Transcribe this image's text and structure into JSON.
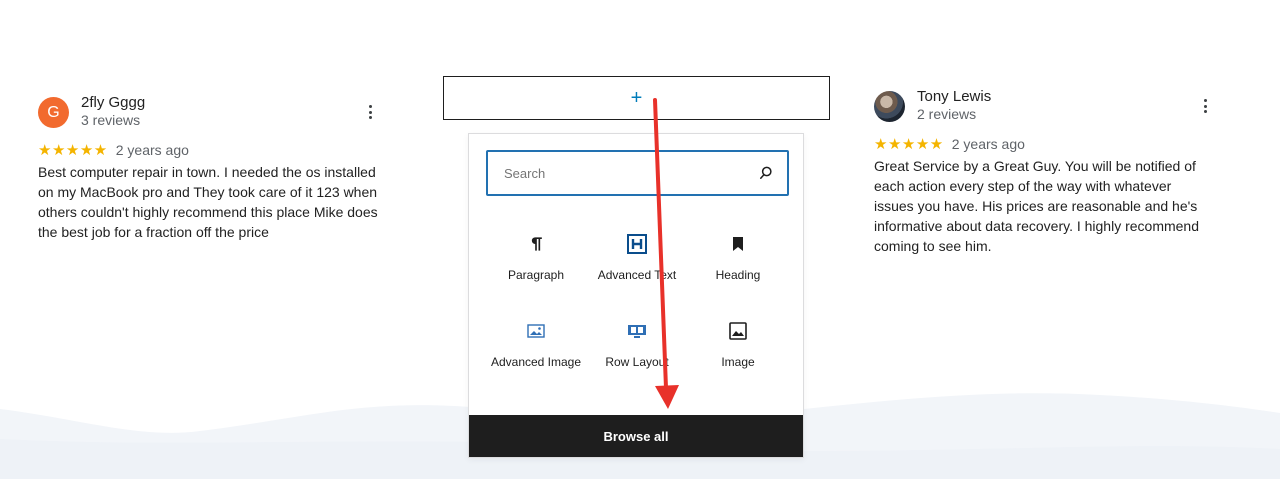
{
  "reviews": [
    {
      "initial": "G",
      "name": "2fly Gggg",
      "count": "3 reviews",
      "stars": "★★★★★",
      "ago": "2 years ago",
      "text": "Best computer repair in town. I needed the os installed on my MacBook pro and They took care of it 123 when others couldn't highly recommend this place Mike does the best job for a fraction off the price"
    },
    {
      "initial": "",
      "name": "Tony Lewis",
      "count": "2 reviews",
      "stars": "★★★★★",
      "ago": "2 years ago",
      "text": "Great Service by a Great Guy. You will be notified of each action every step of the way with whatever issues you have. His prices are reasonable and he's informative about data recovery. I highly recommend coming to see him."
    }
  ],
  "appender": {
    "symbol": "+"
  },
  "inserter": {
    "search_placeholder": "Search",
    "blocks": [
      {
        "label": "Paragraph",
        "icon": "paragraph-icon"
      },
      {
        "label": "Advanced Text",
        "icon": "advanced-heading-icon"
      },
      {
        "label": "Heading",
        "icon": "bookmark-icon"
      },
      {
        "label": "Advanced Image",
        "icon": "advanced-image-icon"
      },
      {
        "label": "Row Layout",
        "icon": "row-layout-icon"
      },
      {
        "label": "Image",
        "icon": "image-icon"
      }
    ],
    "browse_all": "Browse all"
  },
  "colors": {
    "accent": "#2271b1",
    "star": "#f4b400",
    "avatar": "#f26a2e",
    "annotation_arrow": "#e8312a"
  }
}
